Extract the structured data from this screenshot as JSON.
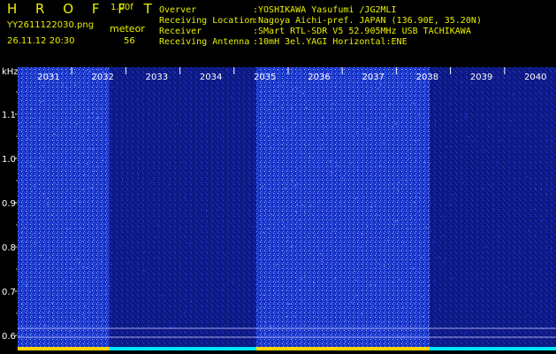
{
  "header": {
    "title": "H R O F F T",
    "version": "1.00f",
    "file_name": "YY2611122030.png",
    "timestamp": "26.11.12 20:30",
    "meteor_label": "meteor",
    "meteor_count": "56"
  },
  "info": [
    {
      "key": "Overver",
      "value": ":YOSHIKAWA Yasufumi /JG2MLI"
    },
    {
      "key": "Receiving Location",
      "value": ":Nagoya Aichi-pref. JAPAN (136.90E, 35.20N)"
    },
    {
      "key": "Receiver",
      "value": ":SMart RTL-SDR V5 52.905MHz USB TACHIKAWA"
    },
    {
      "key": "Receiving Antenna",
      "value": ":10mH 3el.YAGI Horizontal:ENE"
    }
  ],
  "plot": {
    "y_unit": "kHz",
    "y_ticks": [
      "1.1",
      "1.0",
      "0.9",
      "0.8",
      "0.7",
      "0.6"
    ],
    "time_ticks": [
      "2031",
      "2032",
      "2033",
      "2034",
      "2035",
      "2036",
      "2037",
      "2038",
      "2039",
      "2040"
    ],
    "colors": {
      "background": "#000000",
      "dark_noise": "#0d1880",
      "bright_noise": "#2a4cff",
      "speckle": "#9ad6ff",
      "baseline": "#00e5ff",
      "marker": "#ffd400",
      "text": "#e8f000"
    },
    "bright_segments": [
      {
        "from": "2031",
        "to": "2032"
      },
      {
        "from": "2035",
        "to": "2038"
      }
    ]
  }
}
